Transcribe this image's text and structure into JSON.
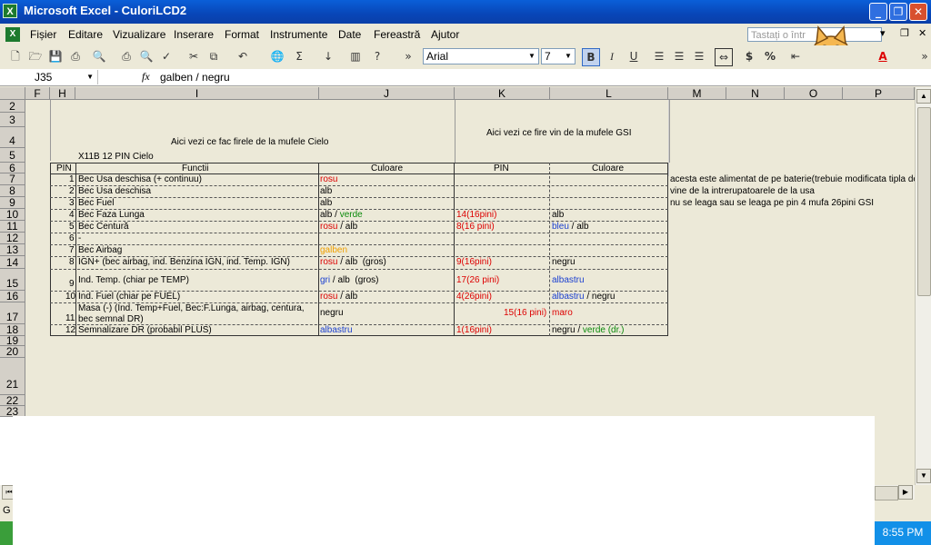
{
  "window": {
    "title": "Microsoft Excel - CuloriLCD2",
    "icon": "excel-icon"
  },
  "menu": {
    "items": [
      "Fișier",
      "Editare",
      "Vizualizare",
      "Inserare",
      "Format",
      "Instrumente",
      "Date",
      "Fereastră",
      "Ajutor"
    ],
    "help_placeholder": "Tastați o într"
  },
  "toolbar": {
    "font": "Arial",
    "size": "7"
  },
  "formula_bar": {
    "name_box": "J35",
    "fx": "fx",
    "formula": "galben / negru"
  },
  "columns": [
    "F",
    "H",
    "I",
    "J",
    "K",
    "L",
    "M",
    "N",
    "O",
    "P"
  ],
  "rows": [
    "2",
    "3",
    "4",
    "5",
    "6",
    "7",
    "8",
    "9",
    "10",
    "11",
    "12",
    "13",
    "14",
    "15",
    "16",
    "17",
    "18",
    "19",
    "20",
    "21",
    "22",
    "23"
  ],
  "sheet": {
    "header_left": "Aici vezi ce fac firele de la mufele Cielo",
    "header_right": "Aici vezi ce fire vin de la mufele GSI",
    "connector": "X11B  12 PIN Cielo",
    "col_pin": "PIN",
    "col_func": "Functii",
    "col_color": "Culoare",
    "col_pin2": "PIN",
    "col_color2": "Culoare",
    "table": [
      {
        "pin": "1",
        "func": "Bec Usa deschisa (+ continuu)",
        "c1": "rosu",
        "c1b": "",
        "c1c": "",
        "p2": "",
        "c2": "",
        "c2b": "",
        "note": "acesta este alimentat de pe baterie(trebuie modificata tipla de pe"
      },
      {
        "pin": "2",
        "func": "Bec Usa deschisa",
        "c1": "alb",
        "c1b": "",
        "c1c": "",
        "p2": "",
        "c2": "",
        "c2b": "",
        "note": "vine de la intrerupatoarele de la usa"
      },
      {
        "pin": "3",
        "func": "Bec Fuel",
        "c1": "alb",
        "c1b": "",
        "c1c": "",
        "p2": "",
        "c2": "",
        "c2b": "",
        "note": "nu se leaga sau se leaga pe pin 4 mufa 26pini GSI"
      },
      {
        "pin": "4",
        "func": "Bec Faza Lunga",
        "c1": "alb",
        "c1b": "verde",
        "c1c": "",
        "p2": "14(16pini)",
        "c2": "alb",
        "c2b": "",
        "note": ""
      },
      {
        "pin": "5",
        "func": "Bec Centură",
        "c1": "rosu",
        "c1b": "alb",
        "c1c": "",
        "p2": "8(16 pini)",
        "c2": "bleu",
        "c2b": "alb",
        "note": ""
      },
      {
        "pin": "6",
        "func": "-",
        "c1": "",
        "c1b": "",
        "c1c": "",
        "p2": "",
        "c2": "",
        "c2b": "",
        "note": ""
      },
      {
        "pin": "7",
        "func": "Bec Airbag",
        "c1": "galben",
        "c1b": "",
        "c1c": "",
        "p2": "",
        "c2": "",
        "c2b": "",
        "note": ""
      },
      {
        "pin": "8",
        "func": "IGN+ (bec airbag, ind. Benzina IGN, ind. Temp. IGN)",
        "c1": "rosu",
        "c1b": "alb",
        "c1c": "(gros)",
        "p2": "9(16pini)",
        "c2": "negru",
        "c2b": "",
        "note": ""
      },
      {
        "pin": "9",
        "func": "Ind. Temp. (chiar pe TEMP)",
        "c1": "gri",
        "c1b": "alb",
        "c1c": "(gros)",
        "p2": "17(26 pini)",
        "c2": "albastru",
        "c2b": "",
        "note": ""
      },
      {
        "pin": "10",
        "func": "Ind. Fuel (chiar pe FUEL)",
        "c1": "rosu",
        "c1b": "alb",
        "c1c": "",
        "p2": "4(26pini)",
        "c2": "albastru",
        "c2b": "negru",
        "note": ""
      },
      {
        "pin": "11",
        "func": "Masa (-) (Ind. Temp+Fuel, Bec:F.Lunga, airbag, centura,",
        "func2": "bec semnal DR)",
        "c1": "negru",
        "c1b": "",
        "c1c": "",
        "p2": "15(16 pini)",
        "c2": "maro",
        "c2b": "",
        "note": ""
      },
      {
        "pin": "12",
        "func": "Semnalizare DR (probabil PLUS)",
        "c1": "albastru",
        "c1b": "",
        "c1c": "",
        "p2": "1(16pini)",
        "c2": "negru",
        "c2b": "verde (dr.)",
        "note": ""
      }
    ]
  },
  "taskbar": {
    "clock": "8:55 PM",
    "tab_label": "G"
  }
}
